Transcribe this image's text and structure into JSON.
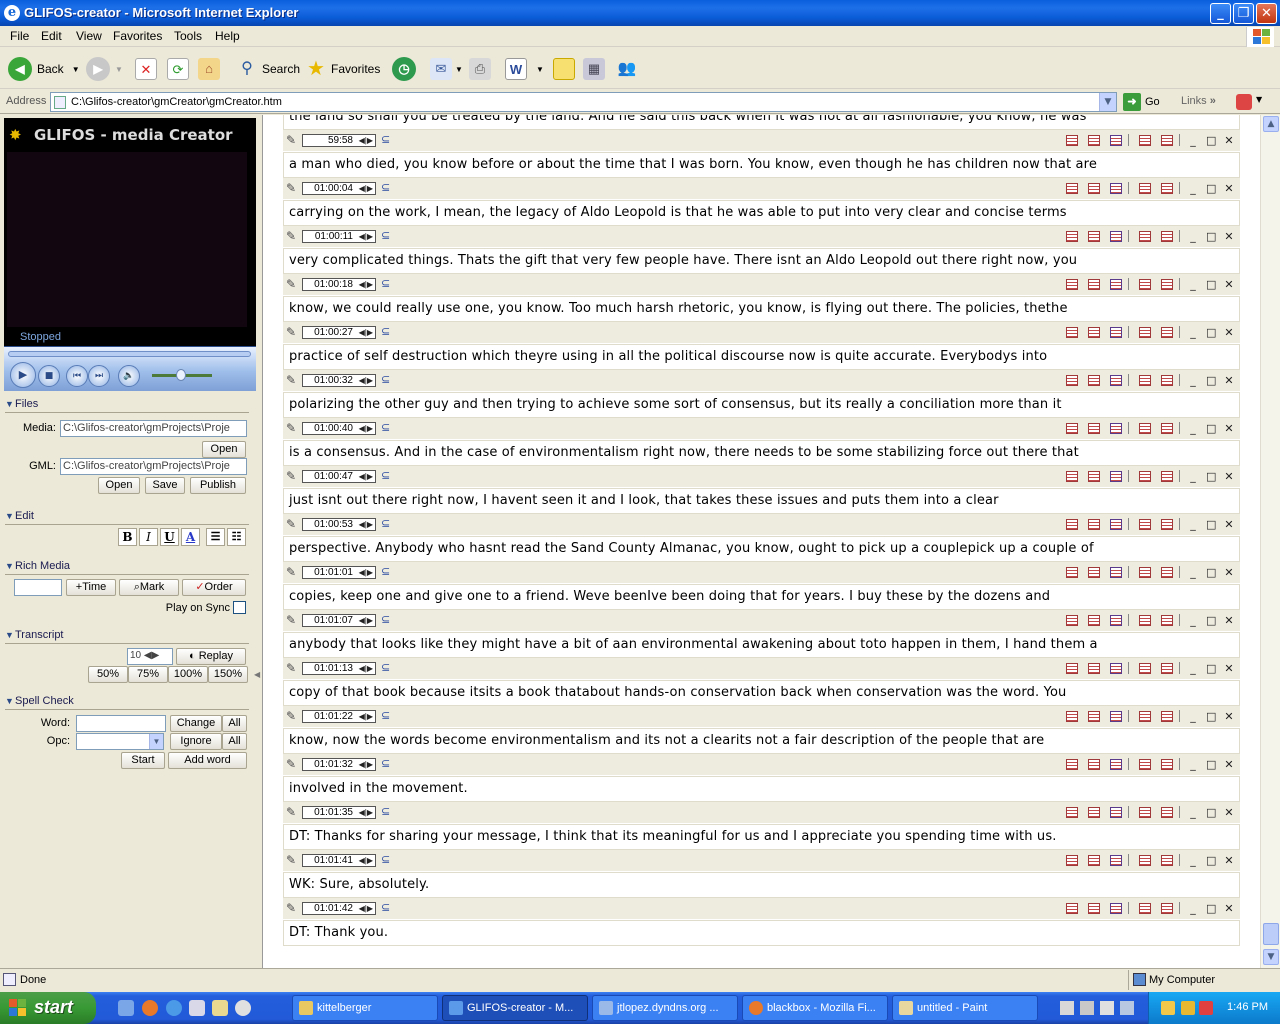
{
  "window": {
    "title": "GLIFOS-creator - Microsoft Internet Explorer"
  },
  "menu": [
    "File",
    "Edit",
    "View",
    "Favorites",
    "Tools",
    "Help"
  ],
  "toolbar": {
    "back": "Back",
    "search": "Search",
    "favorites": "Favorites"
  },
  "address": {
    "label": "Address",
    "value": "C:\\Glifos-creator\\gmCreator\\gmCreator.htm",
    "go": "Go",
    "links": "Links"
  },
  "player": {
    "logo": "GLIFOS - media Creator",
    "status": "Stopped"
  },
  "files": {
    "heading": "Files",
    "media_label": "Media:",
    "media_value": "C:\\Glifos-creator\\gmProjects\\Proje",
    "open": "Open",
    "gml_label": "GML:",
    "gml_value": "C:\\Glifos-creator\\gmProjects\\Proje",
    "open2": "Open",
    "save": "Save",
    "publish": "Publish"
  },
  "edit": {
    "heading": "Edit",
    "bold": "B",
    "italic": "I",
    "underline": "U",
    "color": "A"
  },
  "rich_media": {
    "heading": "Rich Media",
    "time": "+Time",
    "mark": "Mark",
    "order": "Order",
    "play_on_sync": "Play on Sync"
  },
  "transcript": {
    "heading": "Transcript",
    "replay_value": "10",
    "replay": "Replay",
    "speeds": [
      "50%",
      "75%",
      "100%",
      "150%"
    ]
  },
  "spell": {
    "heading": "Spell Check",
    "word_label": "Word:",
    "opc_label": "Opc:",
    "change": "Change",
    "all": "All",
    "ignore": "Ignore",
    "all2": "All",
    "start": "Start",
    "add_word": "Add word"
  },
  "transcript_entries": [
    {
      "time": "",
      "text": "the land so shall you be treated by the land. And he said this back when it was not at all fashionable, you know, he was"
    },
    {
      "time": "59:58",
      "text": "a man who died, you know before or about the time that I was born. You know, even though he has children now that are"
    },
    {
      "time": "01:00:04",
      "text": "carrying on the work, I mean, the legacy of Aldo Leopold is that he was able to put into very clear and concise terms"
    },
    {
      "time": "01:00:11",
      "text": "very complicated things. Thats the gift that very few people have. There isnt an Aldo Leopold out there right now, you"
    },
    {
      "time": "01:00:18",
      "text": "know, we could really use one, you know. Too much harsh rhetoric, you know, is flying out there. The policies, thethe"
    },
    {
      "time": "01:00:27",
      "text": "practice of self destruction which theyre using in all the political discourse now is quite accurate. Everybodys into"
    },
    {
      "time": "01:00:32",
      "text": "polarizing the other guy and then trying to achieve some sort of consensus, but its really a conciliation more than it"
    },
    {
      "time": "01:00:40",
      "text": "is a consensus. And in the case of environmentalism right now, there needs to be some stabilizing force out there that"
    },
    {
      "time": "01:00:47",
      "text": "just isnt out there right now, I havent seen it and I look, that takes these issues and puts them into a clear"
    },
    {
      "time": "01:00:53",
      "text": "perspective. Anybody who hasnt read the Sand County Almanac, you know, ought to pick up a couplepick up a couple of"
    },
    {
      "time": "01:01:01",
      "text": "copies, keep one and give one to a friend. Weve beenIve been doing that for years. I buy these by the dozens and"
    },
    {
      "time": "01:01:07",
      "text": "anybody that looks like they might have a bit of aan environmental awakening about toto happen in them, I hand them a"
    },
    {
      "time": "01:01:13",
      "text": "copy of that book because itsits a book thatabout hands-on conservation back when conservation was the word. You"
    },
    {
      "time": "01:01:22",
      "text": "know, now the words become environmentalism and its not a clearits not a fair description of the people that are"
    },
    {
      "time": "01:01:32",
      "text": "involved in the movement."
    },
    {
      "time": "01:01:35",
      "text": "DT: Thanks for sharing your message, I think that its meaningful for us and I appreciate you spending time with us."
    },
    {
      "time": "01:01:41",
      "text": "WK: Sure, absolutely."
    },
    {
      "time": "01:01:42",
      "text": "DT: Thank you."
    }
  ],
  "statusbar": {
    "status": "Done",
    "zone": "My Computer"
  },
  "taskbar": {
    "start": "start",
    "tasks": [
      {
        "label": "kittelberger"
      },
      {
        "label": "GLIFOS-creator - M..."
      },
      {
        "label": "jtlopez.dyndns.org ..."
      },
      {
        "label": "blackbox - Mozilla Fi..."
      },
      {
        "label": "untitled - Paint"
      }
    ],
    "clock": "1:46 PM"
  }
}
